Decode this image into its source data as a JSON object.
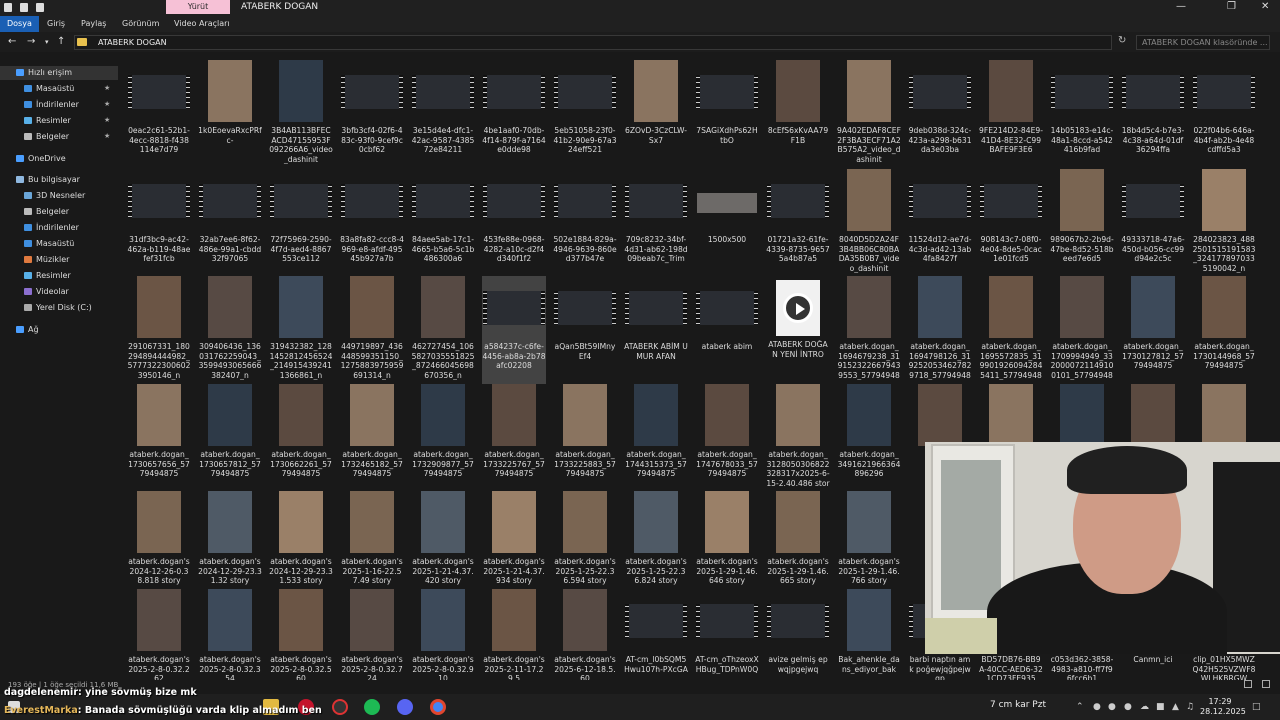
{
  "window": {
    "title": "ATABERK DOGAN",
    "context_tab": "Yürüt"
  },
  "ribbon": {
    "tabs": [
      "Dosya",
      "Giriş",
      "Paylaş",
      "Görünüm",
      "Video Araçları"
    ]
  },
  "address": {
    "crumb": "ATABERK DOGAN",
    "search_placeholder": "ATABERK DOGAN klasöründe ..."
  },
  "sidebar": {
    "items": [
      {
        "label": "Hızlı erişim",
        "icon": "star-icon"
      },
      {
        "label": "Masaüstü",
        "icon": "desktop-icon",
        "pinned": true
      },
      {
        "label": "İndirilenler",
        "icon": "download-icon",
        "pinned": true
      },
      {
        "label": "Resimler",
        "icon": "pictures-icon",
        "pinned": true
      },
      {
        "label": "Belgeler",
        "icon": "documents-icon",
        "pinned": true
      },
      {
        "label": "OneDrive",
        "icon": "cloud-icon"
      },
      {
        "label": "Bu bilgisayar",
        "icon": "computer-icon"
      },
      {
        "label": "3D Nesneler",
        "icon": "cube-icon"
      },
      {
        "label": "Belgeler",
        "icon": "documents-icon"
      },
      {
        "label": "İndirilenler",
        "icon": "download-icon"
      },
      {
        "label": "Masaüstü",
        "icon": "desktop-icon"
      },
      {
        "label": "Müzikler",
        "icon": "music-icon"
      },
      {
        "label": "Resimler",
        "icon": "pictures-icon"
      },
      {
        "label": "Videolar",
        "icon": "video-icon"
      },
      {
        "label": "Yerel Disk (C:)",
        "icon": "disk-icon"
      },
      {
        "label": "Ağ",
        "icon": "network-icon"
      }
    ]
  },
  "files": [
    [
      {
        "name": "0eac2c61-52b1-4ecc-8818-f438114e7d79",
        "kind": "video"
      },
      {
        "name": "1k0EoevaRxcPRfc-",
        "kind": "photo"
      },
      {
        "name": "3B4AB113BFECACD47155953F092266A6_video_dashinit",
        "kind": "photo"
      },
      {
        "name": "3bfb3cf4-02f6-483c-93f0-9cef9c0cbf62",
        "kind": "video"
      },
      {
        "name": "3e15d4e4-dfc1-42ac-9587-438572e84211",
        "kind": "video"
      },
      {
        "name": "4be1aaf0-70db-4f14-879f-a7164e0dde98",
        "kind": "video"
      },
      {
        "name": "5eb51058-23f0-41b2-90e9-67a324eff521",
        "kind": "video"
      },
      {
        "name": "6ZOvD-3CzCLW-Sx7",
        "kind": "photo"
      },
      {
        "name": "7SAGiXdhPs62HtbO",
        "kind": "video"
      },
      {
        "name": "8cEfS6xKvAA79F1B",
        "kind": "photo"
      },
      {
        "name": "9A402EDAF8CEF2F3BA3ECF71A2B575A2_video_dashinit",
        "kind": "photo"
      },
      {
        "name": "9deb038d-324c-423a-a298-b631da3e03ba",
        "kind": "video"
      },
      {
        "name": "9FE214D2-84E9-41D4-8E32-C99BAFE9F3E6",
        "kind": "photo"
      },
      {
        "name": "14b05183-e14c-48a1-8ccd-a542416b9fad",
        "kind": "video"
      },
      {
        "name": "18b4d5c4-b7e3-4c38-a64d-01df36294ffa",
        "kind": "video"
      },
      {
        "name": "022f04b6-646a-4b4f-ab2b-4e48cdffd5a3",
        "kind": "video"
      }
    ],
    [
      {
        "name": "31df3bc9-ac42-462a-b119-48aefef31fcb",
        "kind": "video"
      },
      {
        "name": "32ab7ee6-8f62-486e-99a1-cbdd32f97065",
        "kind": "video"
      },
      {
        "name": "72f75969-2590-4f7d-aed4-8867553ce112",
        "kind": "video"
      },
      {
        "name": "83a8fa82-ccc8-4969-e8-afdf-49545b927a7b",
        "kind": "video"
      },
      {
        "name": "84aee5ab-17c1-4665-b5a6-5c1b486300a6",
        "kind": "video"
      },
      {
        "name": "453fe88e-0968-4282-a10c-d2f4d340f1f2",
        "kind": "video"
      },
      {
        "name": "502e1884-829a-4946-9639-860ed377b47e",
        "kind": "video"
      },
      {
        "name": "709c8232-34bf-4d31-ab62-198d09beab7c_Trim",
        "kind": "video"
      },
      {
        "name": "1500x500",
        "kind": "banner"
      },
      {
        "name": "01721a32-61fe-4339-8735-96575a4b87a5",
        "kind": "video"
      },
      {
        "name": "8040D5D2A24F3B4BB06C80BADA35B0B7_video_dashinit",
        "kind": "photo"
      },
      {
        "name": "11524d12-ae7d-4c3d-ad42-13ab4fa8427f",
        "kind": "video"
      },
      {
        "name": "908143c7-08f0-4e04-8de5-0cac1e01fcd5",
        "kind": "video"
      },
      {
        "name": "989067b2-2b9d-47be-8d52-518beed7e6d5",
        "kind": "photo"
      },
      {
        "name": "49333718-47a6-450d-b056-cc99d94e2c5c",
        "kind": "video"
      },
      {
        "name": "284023823_48825015151915​83_3241778970335190042_n",
        "kind": "photo"
      }
    ],
    [
      {
        "name": "291067331_1802948944449​82_57773223006023950146_n",
        "kind": "photo"
      },
      {
        "name": "309406436_136031762259043_359949306566638240​7_n",
        "kind": "photo"
      },
      {
        "name": "319432382_128145281245652​4_21491543924113668​61_n",
        "kind": "photo"
      },
      {
        "name": "449719897_43644859935115​0_12758839759596​91314_n",
        "kind": "photo"
      },
      {
        "name": "462727454_1065827035551825_87246604569867035​6_n",
        "kind": "photo"
      },
      {
        "name": "a584237c-c6fe-4456-ab8a-2b78afc02208",
        "kind": "video",
        "selected": true
      },
      {
        "name": "aQan5Bt59IMnyEf4",
        "kind": "video"
      },
      {
        "name": "ATABERK ABİM UMUR AFAN",
        "kind": "video"
      },
      {
        "name": "ataberk abim",
        "kind": "video"
      },
      {
        "name": "ATABERK DOĞAN YENİ İNTRO",
        "kind": "play"
      },
      {
        "name": "ataberk.dogan_1694679238_3191523226679439553_5779494875",
        "kind": "photo"
      },
      {
        "name": "ataberk.dogan_1694798126_3192520534627829718_5779494875",
        "kind": "photo"
      },
      {
        "name": "ataberk.dogan_1695572835_3199019260942845411_5779494875",
        "kind": "photo"
      },
      {
        "name": "ataberk.dogan_1709994949_3320000721149100101_5779494875",
        "kind": "photo"
      },
      {
        "name": "ataberk.dogan_1730127812_5779494875",
        "kind": "photo"
      },
      {
        "name": "ataberk.dogan_1730144968_5779494875",
        "kind": "photo"
      }
    ],
    [
      {
        "name": "ataberk.dogan_1730657656_5779494875",
        "kind": "photo"
      },
      {
        "name": "ataberk.dogan_1730657812_5779494875",
        "kind": "photo"
      },
      {
        "name": "ataberk.dogan_1730662261_5779494875",
        "kind": "photo"
      },
      {
        "name": "ataberk.dogan_1732465182_5779494875",
        "kind": "photo"
      },
      {
        "name": "ataberk.dogan_1732909877_5779494875",
        "kind": "photo"
      },
      {
        "name": "ataberk.dogan_1733225767_5779494875",
        "kind": "photo"
      },
      {
        "name": "ataberk.dogan_1733225883_5779494875",
        "kind": "photo"
      },
      {
        "name": "ataberk.dogan_1744315373_5779494875",
        "kind": "photo"
      },
      {
        "name": "ataberk.dogan_1747678033_5779494875",
        "kind": "photo"
      },
      {
        "name": "ataberk.dogan_3128050306822328317x2025-6-15-2.40.486 story",
        "kind": "photo"
      },
      {
        "name": "ataberk.dogan_3491621966364896296",
        "kind": "photo"
      },
      {
        "name": "",
        "kind": "photo"
      },
      {
        "name": "",
        "kind": "photo"
      },
      {
        "name": "",
        "kind": "photo"
      },
      {
        "name": "",
        "kind": "photo"
      },
      {
        "name": "",
        "kind": "photo"
      }
    ],
    [
      {
        "name": "ataberk.dogan's2024-12-26-0.38.818 story",
        "kind": "photo"
      },
      {
        "name": "ataberk.dogan's2024-12-29-23.31.32 story",
        "kind": "photo"
      },
      {
        "name": "ataberk.dogan's2024-12-29-23.31.533 story",
        "kind": "photo"
      },
      {
        "name": "ataberk.dogan's2025-1-16-22.57.49 story",
        "kind": "photo"
      },
      {
        "name": "ataberk.dogan's2025-1-21-4.37.420 story",
        "kind": "photo"
      },
      {
        "name": "ataberk.dogan's2025-1-21-4.37.934 story",
        "kind": "photo"
      },
      {
        "name": "ataberk.dogan's2025-1-25-22.36.594 story",
        "kind": "photo"
      },
      {
        "name": "ataberk.dogan's2025-1-25-22.36.824 story",
        "kind": "photo"
      },
      {
        "name": "ataberk.dogan's2025-1-29-1.46.646 story",
        "kind": "photo"
      },
      {
        "name": "ataberk.dogan's2025-1-29-1.46.665 story",
        "kind": "photo"
      },
      {
        "name": "ataberk.dogan's2025-1-29-1.46.766 story",
        "kind": "photo"
      }
    ],
    [
      {
        "name": "ataberk.dogan's2025-2-8-0.32.262",
        "kind": "photo"
      },
      {
        "name": "ataberk.dogan's2025-2-8-0.32.354",
        "kind": "photo"
      },
      {
        "name": "ataberk.dogan's2025-2-8-0.32.560",
        "kind": "photo"
      },
      {
        "name": "ataberk.dogan's2025-2-8-0.32.724",
        "kind": "photo"
      },
      {
        "name": "ataberk.dogan's2025-2-8-0.32.910",
        "kind": "photo"
      },
      {
        "name": "ataberk.dogan's2025-2-11-17.29.5",
        "kind": "photo"
      },
      {
        "name": "ataberk.dogan's2025-6-12-18.5.60",
        "kind": "photo"
      },
      {
        "name": "AT-cm_l0bSQM5Hwu107h-PXcGA",
        "kind": "video"
      },
      {
        "name": "AT-cm_oThzeoxXHBug_TDPnW0Q",
        "kind": "video"
      },
      {
        "name": "avize gelmiş epwqjpgejwq",
        "kind": "video"
      },
      {
        "name": "Bak_ahenkle_dans_ediyor_bak",
        "kind": "photo"
      },
      {
        "name": "barbi naptın amk poğewjqğpejwqp",
        "kind": "video"
      },
      {
        "name": "BD57DB76-BB9A-40CC-AED6-321CD73FE935",
        "kind": "video"
      },
      {
        "name": "c053d362-3858-4983-a810-ff7f96fcc6b1",
        "kind": "video"
      },
      {
        "name": "Canmn_ici",
        "kind": "video"
      },
      {
        "name": "clip_01HX5MWZQ42H525VZWF8WLHKBRGW",
        "kind": "video"
      }
    ]
  ],
  "status": {
    "text": "193 öğe | 1 öğe seçildi 11,6 MB"
  },
  "chat": [
    {
      "user": "dagdelenemir",
      "message": ": yine sövmüş bize mk"
    },
    {
      "user": "EverestMarka",
      "message": ": Banada sövmüşlüğü varda klip almadım ben"
    }
  ],
  "taskbar": {
    "weather": "7 cm kar Pzt",
    "time": "17:29",
    "date": "28.12.2025"
  },
  "colors": {
    "accent": "#1a5fb4",
    "context_tab": "#f6c1d6",
    "folder": "#e8c14e",
    "chat_user2": "#e6b85a"
  }
}
